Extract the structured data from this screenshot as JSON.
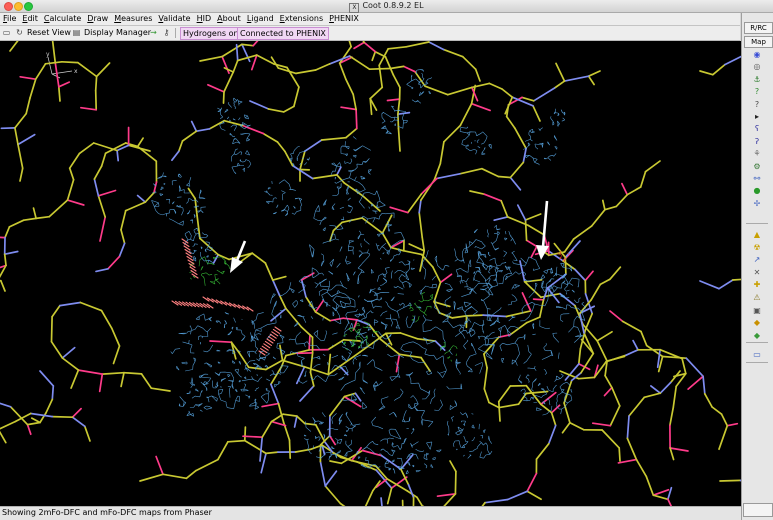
{
  "window": {
    "title": "Coot 0.8.9.2 EL"
  },
  "menubar": {
    "items": [
      "File",
      "Edit",
      "Calculate",
      "Draw",
      "Measures",
      "Validate",
      "HID",
      "About",
      "Ligand",
      "Extensions",
      "PHENIX"
    ]
  },
  "toolbar": {
    "reset_view": "Reset View",
    "display_manager": "Display Manager",
    "hydrogens_status": "Hydrogens on",
    "phenix_status": "Connected to PHENIX"
  },
  "right_panel": {
    "top_label": "R/RC",
    "map_label": "Map",
    "tool_icons": [
      {
        "name": "refine-icon",
        "glyph": "◉",
        "color": "#3b4fd6"
      },
      {
        "name": "regularize-icon",
        "glyph": "◎",
        "color": "#555555"
      },
      {
        "name": "rigid-body-icon",
        "glyph": "⚓",
        "color": "#2b7a2b"
      },
      {
        "name": "rotamer-icon",
        "glyph": "?",
        "color": "#2f8a2f"
      },
      {
        "name": "auto-fit-rotamer-icon",
        "glyph": "?",
        "color": "#4a4a4a"
      },
      {
        "name": "flip-peptide-icon",
        "glyph": "▸",
        "color": "#222222"
      },
      {
        "name": "side-chain-icon",
        "glyph": "ʕ",
        "color": "#2e2e9e"
      },
      {
        "name": "mutate-icon",
        "glyph": "ʔ",
        "color": "#2e2e9e"
      },
      {
        "name": "add-atom-icon",
        "glyph": "⚘",
        "color": "#6b6b6b"
      },
      {
        "name": "edit-chi-icon",
        "glyph": "⚙",
        "color": "#3a7a3a"
      },
      {
        "name": "torsion-icon",
        "glyph": "⚯",
        "color": "#3b5fbf"
      },
      {
        "name": "add-water-icon",
        "glyph": "●",
        "color": "#2a9a2a"
      },
      {
        "name": "rotate-translate-icon",
        "glyph": "✢",
        "color": "#3b5fbf"
      }
    ],
    "tool_icons_2": [
      {
        "name": "baton-icon",
        "glyph": "▲",
        "color": "#c9a000"
      },
      {
        "name": "radiation-icon",
        "glyph": "☢",
        "color": "#c9a000"
      },
      {
        "name": "measure-distance-icon",
        "glyph": "↗",
        "color": "#3b5fbf"
      },
      {
        "name": "crosshair-icon",
        "glyph": "✕",
        "color": "#555555"
      },
      {
        "name": "add-alt-conf-icon",
        "glyph": "✚",
        "color": "#c9a000"
      },
      {
        "name": "label-icon",
        "glyph": "⚠",
        "color": "#8a7a2a"
      },
      {
        "name": "delete-icon",
        "glyph": "▣",
        "color": "#555555"
      },
      {
        "name": "undo-icon",
        "glyph": "◆",
        "color": "#c99000"
      },
      {
        "name": "redo-icon",
        "glyph": "◆",
        "color": "#3a9a3a"
      }
    ],
    "tool_icons_3": [
      {
        "name": "screen-icon",
        "glyph": "▭",
        "color": "#3b5fbf"
      }
    ]
  },
  "status_bar": {
    "text": "Showing 2mFo-DFC and mFo-DFC maps from Phaser"
  },
  "viewport": {
    "background": "#000000",
    "density_2fofc_color": "#5aa9e6",
    "density_fofc_color": "#39c339",
    "difference_negative_color": "#e0301e",
    "carbon_color": "#c8c832",
    "nitrogen_color": "#7e8cf0",
    "oxygen_color": "#ff3b8a",
    "hydrogen_color": "#ff8080",
    "annotation_color": "#ffffff"
  }
}
